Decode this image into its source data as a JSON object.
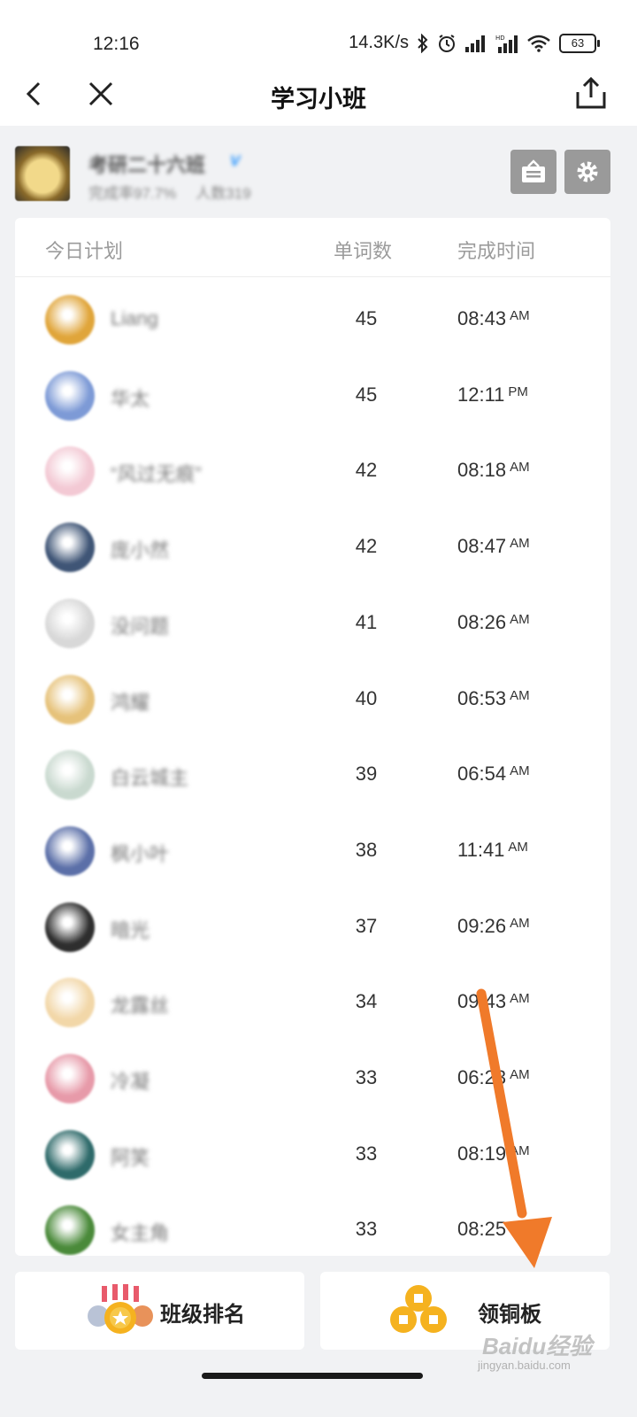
{
  "status_bar": {
    "time": "12:16",
    "speed": "14.3K/s",
    "battery": "63"
  },
  "nav": {
    "title": "学习小班"
  },
  "class": {
    "name": "考研二十六班",
    "badge": "V",
    "completion": "完成率97.7%",
    "members": "人数319"
  },
  "table": {
    "headers": {
      "plan": "今日计划",
      "words": "单词数",
      "time": "完成时间"
    },
    "rows": [
      {
        "name": "Liang",
        "words": "45",
        "time": "08:43",
        "ampm": "AM",
        "avatar": "#e0a53a"
      },
      {
        "name": "华太",
        "words": "45",
        "time": "12:11",
        "ampm": "PM",
        "avatar": "#7d9ad6"
      },
      {
        "name": "“风过无痕”",
        "words": "42",
        "time": "08:18",
        "ampm": "AM",
        "avatar": "#f3c9d4"
      },
      {
        "name": "庞小然",
        "words": "42",
        "time": "08:47",
        "ampm": "AM",
        "avatar": "#3f5576"
      },
      {
        "name": "没问题",
        "words": "41",
        "time": "08:26",
        "ampm": "AM",
        "avatar": "#d8d8d8"
      },
      {
        "name": "鸿耀",
        "words": "40",
        "time": "06:53",
        "ampm": "AM",
        "avatar": "#e6c27a"
      },
      {
        "name": "白云城主",
        "words": "39",
        "time": "06:54",
        "ampm": "AM",
        "avatar": "#c9d9cf"
      },
      {
        "name": "枫小叶",
        "words": "38",
        "time": "11:41",
        "ampm": "AM",
        "avatar": "#5b6fa8"
      },
      {
        "name": "暗光",
        "words": "37",
        "time": "09:26",
        "ampm": "AM",
        "avatar": "#2e2e2e"
      },
      {
        "name": "龙露丝",
        "words": "34",
        "time": "09:43",
        "ampm": "AM",
        "avatar": "#f2d7a8"
      },
      {
        "name": "冷凝",
        "words": "33",
        "time": "06:23",
        "ampm": "AM",
        "avatar": "#e79aa9"
      },
      {
        "name": "阿笑",
        "words": "33",
        "time": "08:19",
        "ampm": "AM",
        "avatar": "#2e6a6a"
      },
      {
        "name": "女主角",
        "words": "33",
        "time": "08:25",
        "ampm": "AM",
        "avatar": "#4a8a3a"
      }
    ]
  },
  "bottom": {
    "ranking_label": "班级排名",
    "coin_label": "领铜板"
  },
  "watermark": {
    "brand": "Baidu经验",
    "url": "jingyan.baidu.com"
  },
  "colors": {
    "arrow": "#f07a2a",
    "header_button": "#9a9a9a",
    "coin": "#f5b21f"
  }
}
